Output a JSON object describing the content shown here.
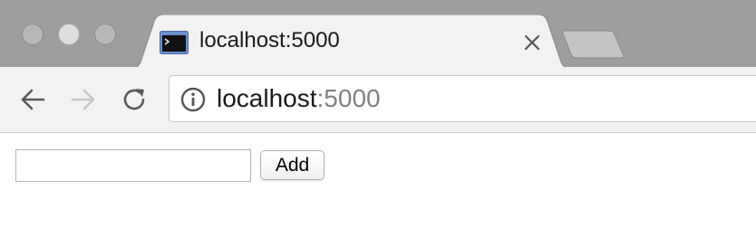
{
  "window": {
    "controls": [
      "close",
      "minimize",
      "zoom"
    ]
  },
  "tab": {
    "title": "localhost:5000",
    "favicon": "terminal-icon",
    "close_icon": "close-icon"
  },
  "new_tab": {
    "icon": "new-tab-icon"
  },
  "toolbar": {
    "back_icon": "arrow-left-icon",
    "forward_icon": "arrow-right-icon",
    "reload_icon": "reload-icon",
    "forward_enabled": false
  },
  "omnibox": {
    "icon": "info-icon",
    "host": "localhost",
    "port": ":5000"
  },
  "page": {
    "input_value": "",
    "add_label": "Add"
  },
  "colors": {
    "tabstrip": "#9e9e9e",
    "toolbar": "#f2f2f2",
    "url_host": "#1a1a1a",
    "url_port": "#808080"
  }
}
